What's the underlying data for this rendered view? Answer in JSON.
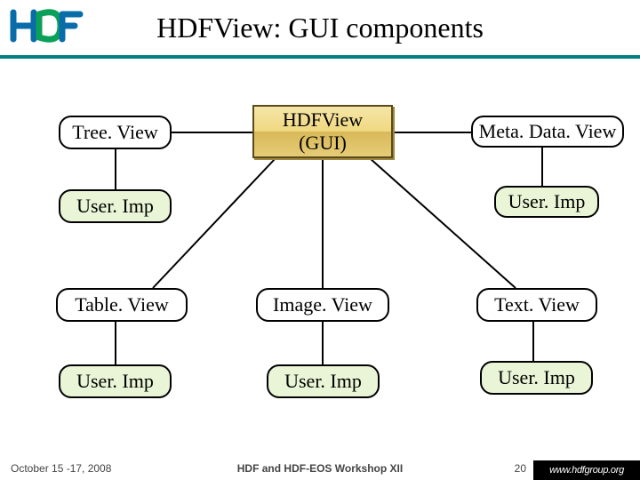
{
  "title": "HDFView: GUI components",
  "central": {
    "line1": "HDFView",
    "line2": "(GUI)"
  },
  "nodes": {
    "treeView": "Tree. View",
    "metaDataView": "Meta. Data. View",
    "userImpTL": "User. Imp",
    "userImpTR": "User. Imp",
    "tableView": "Table. View",
    "imageView": "Image. View",
    "textView": "Text. View",
    "userImpBL": "User. Imp",
    "userImpBC": "User. Imp",
    "userImpBR": "User. Imp"
  },
  "footer": {
    "date": "October 15 -17, 2008",
    "venue": "HDF and HDF-EOS Workshop XII",
    "page": "20",
    "url": "www.hdfgroup.org"
  }
}
